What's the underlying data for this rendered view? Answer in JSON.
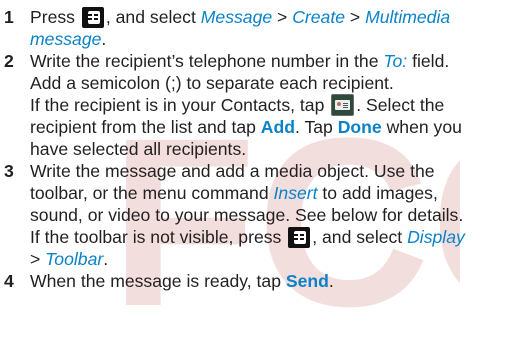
{
  "colors": {
    "text": "#231f20",
    "accent": "#0a82c8",
    "watermark": "#f3dede"
  },
  "watermark": {
    "text": "FCC",
    "color": "#f3dede"
  },
  "steps": [
    {
      "number": "1",
      "line1": {
        "prefix": "Press",
        "icon": "menu-key-icon",
        "middle": ", and select",
        "menu1": "Message",
        "sep1": ">",
        "menu2": "Create",
        "sep2": ">",
        "menu3a": "Multimedia"
      },
      "line2": {
        "menu3b": "message",
        "end": "."
      }
    },
    {
      "number": "2",
      "line1": {
        "before": "Write the recipient’s telephone number in the",
        "field": "To:",
        "after": "field."
      },
      "line2": {
        "text": "Add a semicolon (;) to separate each recipient."
      },
      "line3": {
        "before": "If the recipient is in your Contacts, tap",
        "icon": "contacts-key-icon",
        "after": ". Select the"
      },
      "line4": {
        "before": "recipient from the list and tap",
        "button1": "Add",
        "middle": ". Tap",
        "button2": "Done",
        "after": "when you"
      },
      "line5": {
        "text": "have selected all recipients."
      }
    },
    {
      "number": "3",
      "line1": {
        "text": "Write the message and add a media object. Use the"
      },
      "line2": {
        "before": "toolbar, or the menu command",
        "cmd": "Insert",
        "after": "to add images,"
      },
      "line3": {
        "text": "sound, or video to your message. See below for details."
      },
      "line4": {
        "before": "If the toolbar is not visible, press",
        "icon": "menu-key-icon",
        "middle": ", and select",
        "menu1": "Display"
      },
      "line5": {
        "sep": ">",
        "menu2": "Toolbar",
        "end": "."
      }
    },
    {
      "number": "4",
      "line1": {
        "before": "When the message is ready, tap",
        "button": "Send",
        "end": "."
      }
    }
  ]
}
